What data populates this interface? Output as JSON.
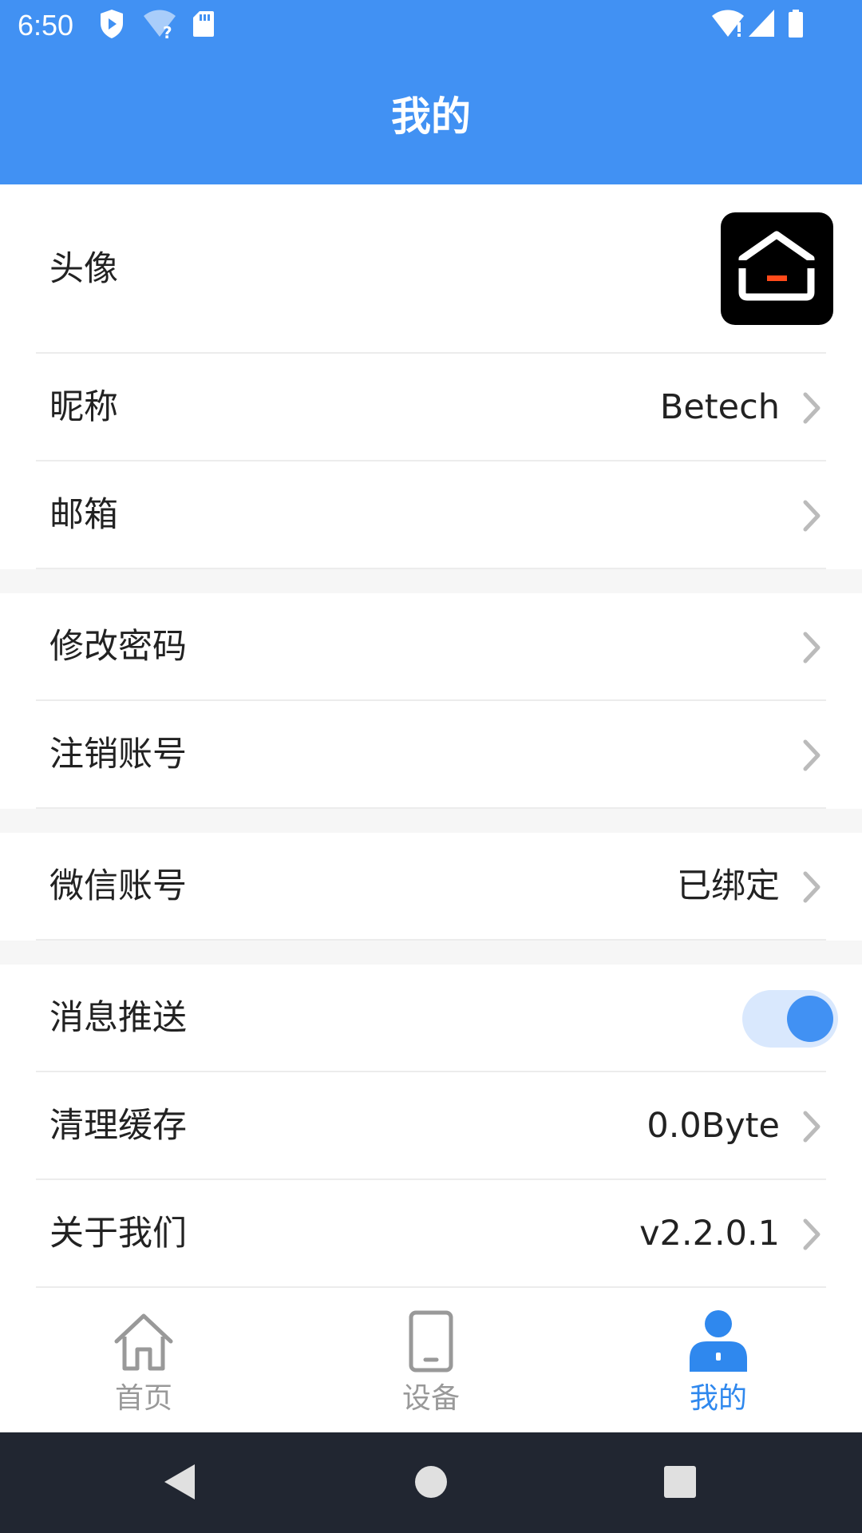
{
  "status_bar": {
    "time": "6:50",
    "icons_left": [
      "shield-icon",
      "wifi-question-icon",
      "sd-card-icon"
    ],
    "icons_right": [
      "wifi-alert-icon",
      "signal-icon",
      "battery-icon"
    ]
  },
  "header": {
    "title": "我的"
  },
  "profile": {
    "avatar_label": "头像",
    "nickname_label": "昵称",
    "nickname_value": "Betech",
    "email_label": "邮箱",
    "email_value": ""
  },
  "security": {
    "change_password_label": "修改密码",
    "delete_account_label": "注销账号"
  },
  "wechat": {
    "label": "微信账号",
    "value": "已绑定"
  },
  "settings": {
    "push_label": "消息推送",
    "push_enabled": true,
    "cache_label": "清理缓存",
    "cache_value": "0.0Byte",
    "about_label": "关于我们",
    "about_value": "v2.2.0.1"
  },
  "bottom_nav": {
    "items": [
      {
        "label": "首页",
        "icon": "home-icon",
        "active": false
      },
      {
        "label": "设备",
        "icon": "device-icon",
        "active": false
      },
      {
        "label": "我的",
        "icon": "person-icon",
        "active": true
      }
    ]
  },
  "colors": {
    "primary": "#4191F3",
    "active_nav": "#2F88EE",
    "inactive_nav": "#999999",
    "section_gap": "#F6F6F6",
    "system_nav": "#212631",
    "avatar_accent": "#FF4A1A"
  }
}
